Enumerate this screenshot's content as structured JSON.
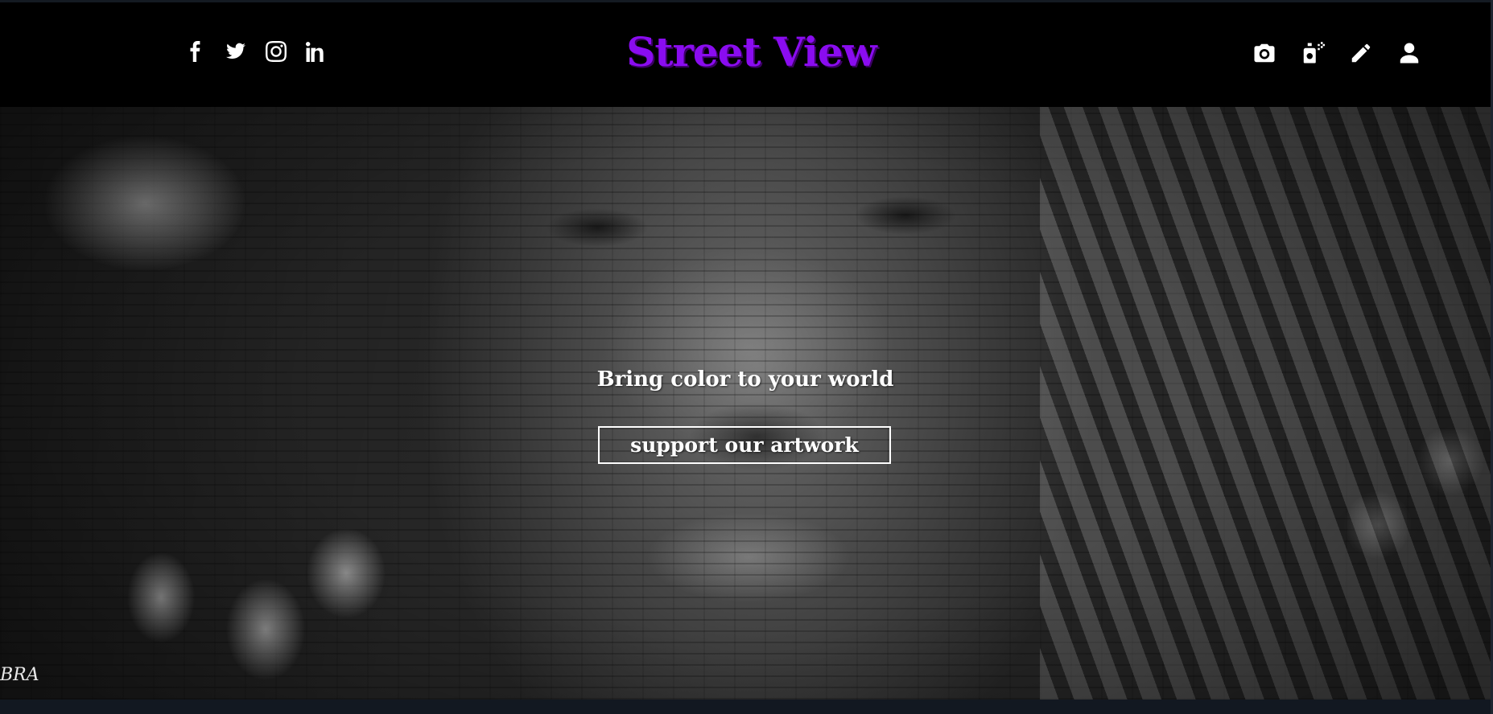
{
  "header": {
    "brand": "Street View",
    "brand_color": "#8a0cf0",
    "social_icons": [
      "facebook-icon",
      "twitter-icon",
      "instagram-icon",
      "linkedin-icon"
    ],
    "tool_icons": [
      "camera-icon",
      "spray-can-icon",
      "pencil-icon",
      "user-icon"
    ]
  },
  "hero": {
    "tagline": "Bring color to your world",
    "cta_label": "support our artwork"
  }
}
